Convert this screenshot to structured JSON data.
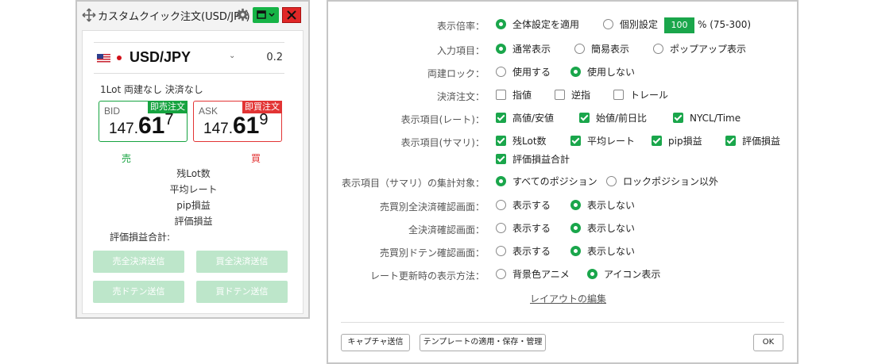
{
  "widget": {
    "title": "カスタムクイック注文(USD/JPY)",
    "icons": {
      "move": "move-icon",
      "gear": "gear-icon",
      "window": "window-icon",
      "close": "close-icon"
    },
    "colors": {
      "buy": "#e23434",
      "sell": "#16a340",
      "accent": "#16b346"
    },
    "pair": "USD/JPY",
    "spread": "0.2",
    "lot_info": "1Lot 両建なし 決済なし",
    "bid": {
      "label": "BID",
      "button": "即売注文",
      "price_main": "147.",
      "price_big": "61",
      "price_sup": "7"
    },
    "ask": {
      "label": "ASK",
      "button": "即買注文",
      "price_main": "147.",
      "price_big": "61",
      "price_sup": "9"
    },
    "sell_label": "売",
    "buy_label": "買",
    "stats": [
      "残Lot数",
      "平均レート",
      "pip損益",
      "評価損益"
    ],
    "stats_total": "評価損益合計:",
    "buttons": [
      "売全決済送信",
      "買全決済送信",
      "売ドテン送信",
      "買ドテン送信"
    ]
  },
  "settings": {
    "zoom": {
      "label": "表示倍率：",
      "opt1": "全体設定を適用",
      "opt2": "個別設定",
      "value": "100",
      "range": "% (75-300)"
    },
    "input": {
      "label": "入力項目：",
      "opts": [
        "通常表示",
        "簡易表示",
        "ポップアップ表示"
      ]
    },
    "hedge_lock": {
      "label": "両建ロック：",
      "opts": [
        "使用する",
        "使用しない"
      ]
    },
    "settle_order": {
      "label": "決済注文：",
      "opts": [
        "指値",
        "逆指",
        "トレール"
      ]
    },
    "rate_items": {
      "label": "表示項目(レート)：",
      "opts": [
        "高値/安値",
        "始値/前日比",
        "NYCL/Time"
      ]
    },
    "summary_items": {
      "label": "表示項目(サマリ)：",
      "opts": [
        "残Lot数",
        "平均レート",
        "pip損益",
        "評価損益",
        "評価損益合計"
      ]
    },
    "summary_target": {
      "label": "表示項目（サマリ）の集計対象：",
      "opts": [
        "すべてのポジション",
        "ロックポジション以外"
      ]
    },
    "side_all_settle": {
      "label": "売買別全決済確認画面：",
      "opts": [
        "表示する",
        "表示しない"
      ]
    },
    "all_settle": {
      "label": "全決済確認画面：",
      "opts": [
        "表示する",
        "表示しない"
      ]
    },
    "side_doten": {
      "label": "売買別ドテン確認画面：",
      "opts": [
        "表示する",
        "表示しない"
      ]
    },
    "rate_update": {
      "label": "レート更新時の表示方法：",
      "opts": [
        "背景色アニメ",
        "アイコン表示"
      ]
    },
    "edit_layout": "レイアウトの編集",
    "buttons": {
      "capture": "キャプチャ送信",
      "template": "テンプレートの適用・保存・管理",
      "ok": "OK"
    }
  }
}
